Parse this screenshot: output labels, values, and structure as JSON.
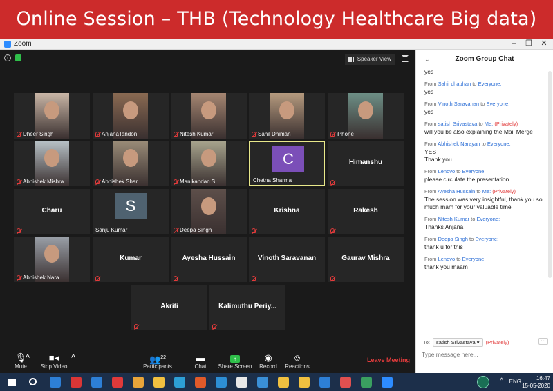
{
  "banner": {
    "title": "Online Session – THB (Technology Healthcare Big data)"
  },
  "window": {
    "app_name": "Zoom",
    "minimize": "–",
    "restore": "❐",
    "close": "✕"
  },
  "meeting": {
    "speaker_view_label": "Speaker View",
    "tiles": [
      {
        "name": "Dheer Singh",
        "type": "photo"
      },
      {
        "name": "AnjanaTandon",
        "type": "photo"
      },
      {
        "name": "Nitesh Kumar",
        "type": "photo"
      },
      {
        "name": "Sahil Dhiman",
        "type": "photo"
      },
      {
        "name": "iPhone",
        "type": "photo"
      },
      {
        "name": "Abhishek Mishra",
        "type": "photo"
      },
      {
        "name": "Abhishek Shar...",
        "type": "photo"
      },
      {
        "name": "Manikandan S...",
        "type": "photo"
      },
      {
        "name": "Chetna Sharma",
        "type": "avatar",
        "initial": "C",
        "avatar_color": "#7b4fb8"
      },
      {
        "name": "Himanshu",
        "type": "name"
      },
      {
        "name": "Charu",
        "type": "name"
      },
      {
        "name": "Sanju Kumar",
        "type": "avatar",
        "initial": "S",
        "avatar_color": "#4f6270"
      },
      {
        "name": "Deepa Singh",
        "type": "photo"
      },
      {
        "name": "Krishna",
        "type": "name"
      },
      {
        "name": "Rakesh",
        "type": "name"
      },
      {
        "name": "Abhishek Nara...",
        "type": "photo"
      },
      {
        "name": "Kumar",
        "type": "name"
      },
      {
        "name": "Ayesha Hussain",
        "type": "name"
      },
      {
        "name": "Vinoth Saravanan",
        "type": "name"
      },
      {
        "name": "Gaurav Mishra",
        "type": "name"
      },
      {
        "name": "Akriti",
        "type": "name"
      },
      {
        "name": "Kalimuthu Periy...",
        "type": "name"
      }
    ]
  },
  "toolbar": {
    "mute": "Mute",
    "stop_video": "Stop Video",
    "participants": "Participants",
    "participants_count": "22",
    "chat": "Chat",
    "share_screen": "Share Screen",
    "record": "Record",
    "reactions": "Reactions",
    "leave": "Leave Meeting"
  },
  "chat": {
    "title": "Zoom Group Chat",
    "first_line": "yes",
    "messages": [
      {
        "from": "Sahil chauhan",
        "to": "Everyone",
        "private": false,
        "text": "yes"
      },
      {
        "from": "Vinoth Saravanan",
        "to": "Everyone",
        "private": false,
        "text": "yes"
      },
      {
        "from": "satish Srivastava",
        "to": "Me",
        "private": true,
        "text": "will you be also explaining the Mail Merge"
      },
      {
        "from": "Abhishek Narayan",
        "to": "Everyone",
        "private": false,
        "text": "YES\nThank you"
      },
      {
        "from": "Lenovo",
        "to": "Everyone",
        "private": false,
        "text": "please circulate the presentation"
      },
      {
        "from": "Ayesha Hussain",
        "to": "Me",
        "private": true,
        "text": "The session was very insightful, thank you so much mam for your valuable time"
      },
      {
        "from": "Nitesh Kumar",
        "to": "Everyone",
        "private": false,
        "text": "Thanks Anjana"
      },
      {
        "from": "Deepa Singh",
        "to": "Everyone",
        "private": false,
        "text": "thank u for this"
      },
      {
        "from": "Lenovo",
        "to": "Everyone",
        "private": false,
        "text": "thank you maam"
      }
    ],
    "from_word": "From",
    "to_word": "to",
    "private_tag": "(Privately)",
    "to_label": "To:",
    "to_selected": "satish Srivastava",
    "to_private": "(Privately)",
    "input_placeholder": "Type message here..."
  },
  "taskbar": {
    "lang": "ENG",
    "time": "16:47",
    "date": "15-05-2020"
  }
}
